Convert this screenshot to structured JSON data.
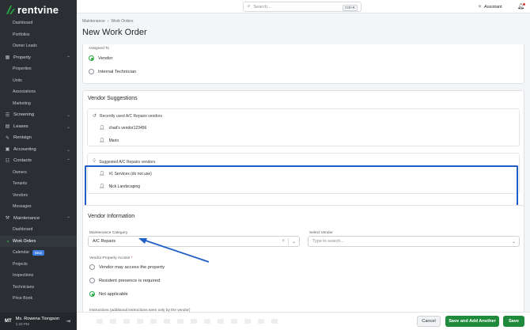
{
  "app": {
    "logo_text": "rentvine"
  },
  "sidebar": {
    "items": [
      {
        "label": "Dashboard",
        "type": "child"
      },
      {
        "label": "Portfolios",
        "type": "child"
      },
      {
        "label": "Owner Leads",
        "type": "child"
      },
      {
        "label": "Property",
        "type": "section",
        "icon": "building-icon",
        "expanded": true
      },
      {
        "label": "Properties",
        "type": "child"
      },
      {
        "label": "Units",
        "type": "child"
      },
      {
        "label": "Associations",
        "type": "child"
      },
      {
        "label": "Marketing",
        "type": "child"
      },
      {
        "label": "Screening",
        "type": "section",
        "icon": "checklist-icon",
        "expanded": false
      },
      {
        "label": "Leases",
        "type": "section",
        "icon": "document-icon",
        "expanded": false
      },
      {
        "label": "Rentsign",
        "type": "section",
        "icon": "pen-icon"
      },
      {
        "label": "Accounting",
        "type": "section",
        "icon": "calculator-icon",
        "expanded": false
      },
      {
        "label": "Contacts",
        "type": "section",
        "icon": "contacts-icon",
        "expanded": true
      },
      {
        "label": "Owners",
        "type": "child"
      },
      {
        "label": "Tenants",
        "type": "child"
      },
      {
        "label": "Vendors",
        "type": "child"
      },
      {
        "label": "Messages",
        "type": "child"
      },
      {
        "label": "Maintenance",
        "type": "section",
        "icon": "wrench-icon",
        "expanded": true
      },
      {
        "label": "Dashboard",
        "type": "child"
      },
      {
        "label": "Work Orders",
        "type": "child",
        "active": true
      },
      {
        "label": "Calendar",
        "type": "child",
        "badge": "Beta"
      },
      {
        "label": "Projects",
        "type": "child"
      },
      {
        "label": "Inspections",
        "type": "child"
      },
      {
        "label": "Technicians",
        "type": "child"
      },
      {
        "label": "Price Book",
        "type": "child"
      }
    ],
    "user": {
      "initials": "MT",
      "name": "Ms. Rowena Tiongson",
      "time": "1:23 PM"
    }
  },
  "topbar": {
    "search_placeholder": "Search...",
    "search_shortcut": "Ctrl+K",
    "assistant_label": "Assistant"
  },
  "breadcrumb": {
    "parent": "Maintenance",
    "current": "Work Orders"
  },
  "page_title": "New Work Order",
  "assigned_to": {
    "label": "Assigned To",
    "options": [
      {
        "label": "Vendor",
        "checked": true
      },
      {
        "label": "Internal Technician",
        "checked": false
      }
    ]
  },
  "vendor_suggestions": {
    "title": "Vendor Suggestions",
    "recent": {
      "heading": "Recently used A/C Repairs vendors",
      "vendors": [
        "chad's vendor123456",
        "Mario"
      ]
    },
    "suggested": {
      "heading": "Suggested A/C Repairs vendors",
      "vendors": [
        "#1 Services (do not use)",
        "Nick Landscaping"
      ]
    }
  },
  "vendor_information": {
    "title": "Vendor Information",
    "maintenance_category_label": "Maintenance Category",
    "maintenance_category_value": "A/C Repairs",
    "select_vendor_label": "Select Vendor",
    "select_vendor_placeholder": "Type to search...",
    "property_access_label": "Vendor Property Access",
    "required_mark": "*",
    "property_access_options": [
      {
        "label": "Vendor may access the property",
        "checked": false
      },
      {
        "label": "Resident presence is required",
        "checked": false
      },
      {
        "label": "Not applicable",
        "checked": true
      }
    ],
    "instructions_label": "Instructions (additional instructions seen only by the vendor)"
  },
  "footer": {
    "cancel_label": "Cancel",
    "save_another_label": "Save and Add Another",
    "save_label": "Save"
  },
  "colors": {
    "sidebar_bg": "#2b2f33",
    "accent_green": "#1e8a3b",
    "highlight_blue": "#1f5fc6",
    "annotation_arrow": "#1f5fc6"
  }
}
